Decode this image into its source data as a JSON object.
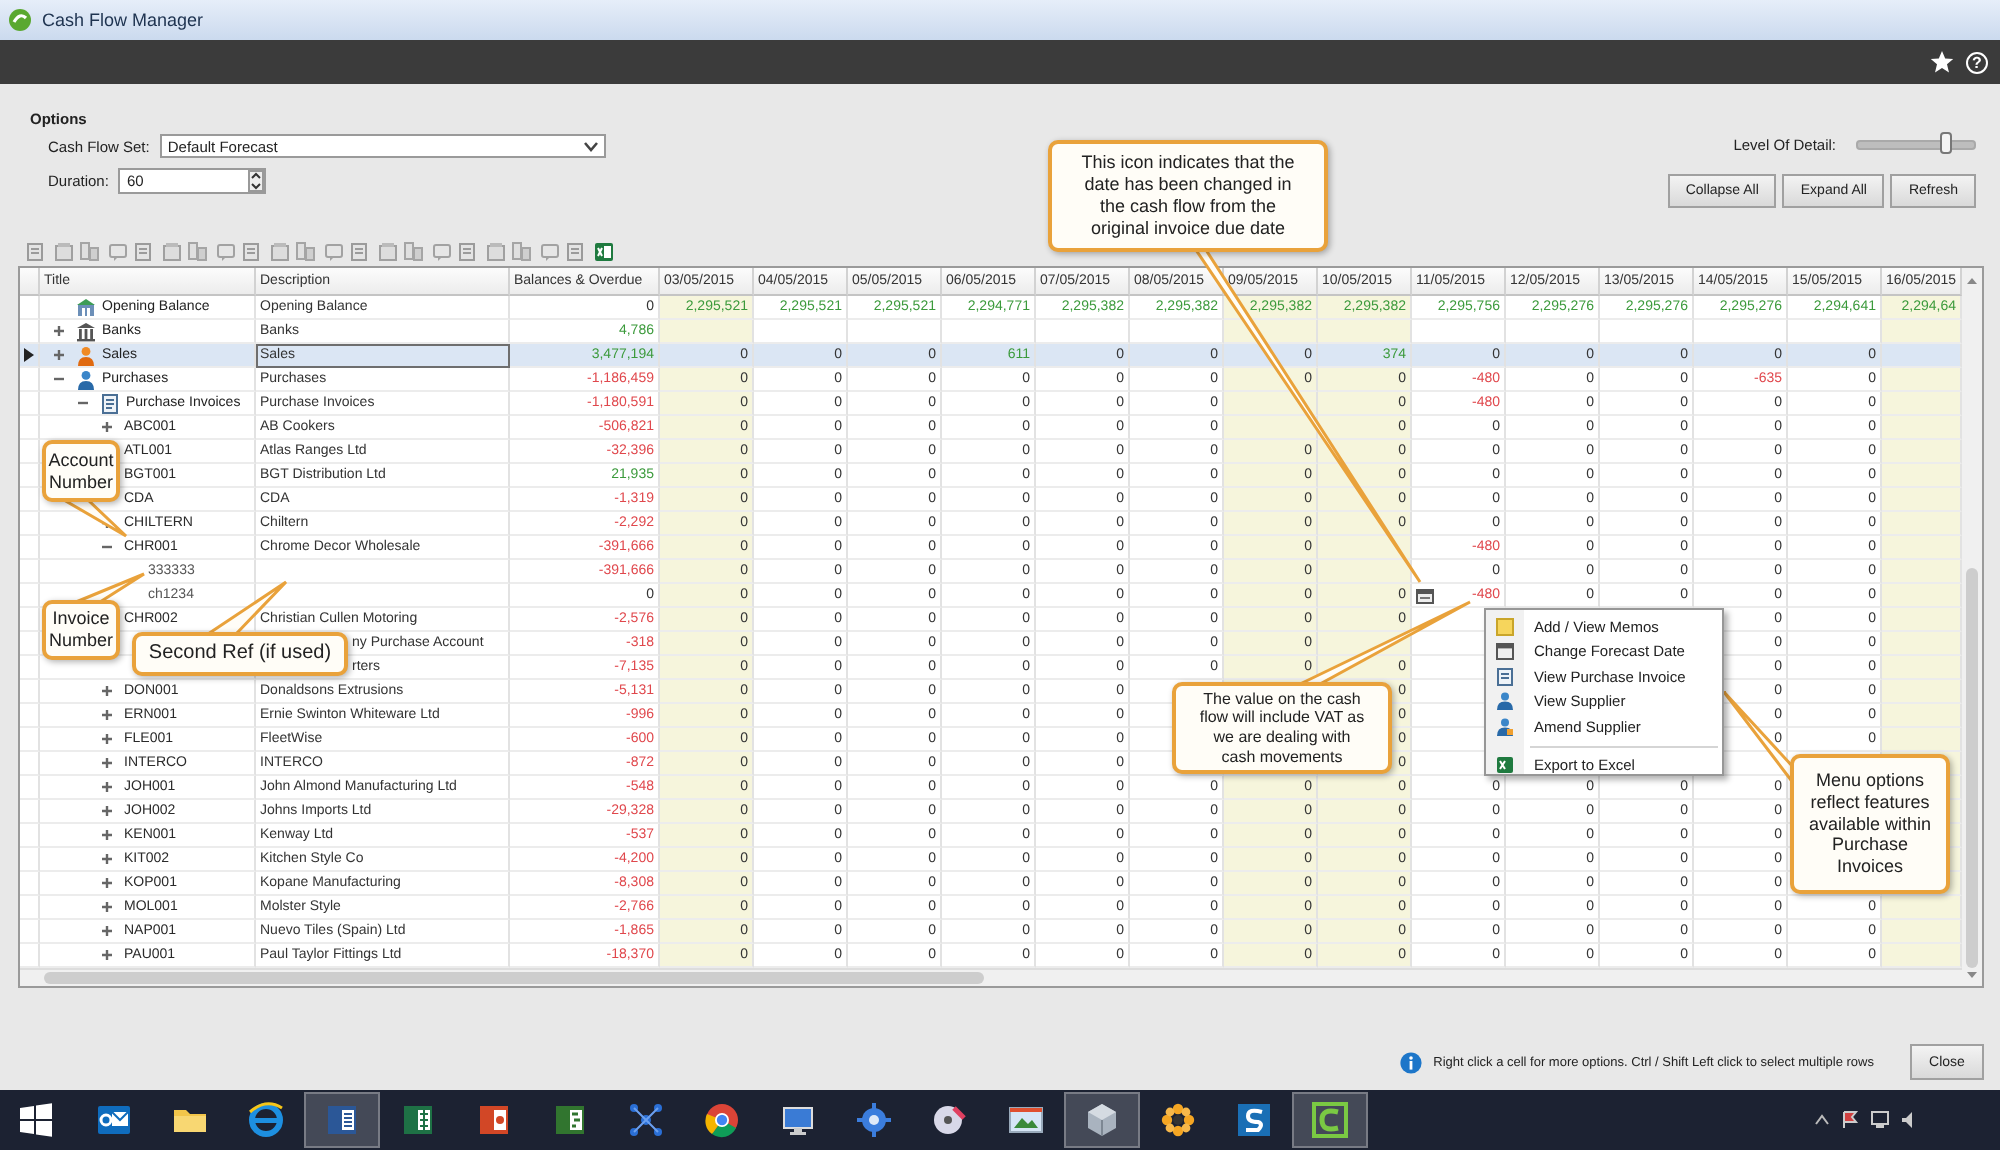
{
  "window": {
    "title": "Cash Flow Manager",
    "help_label": "?"
  },
  "options": {
    "title": "Options",
    "cash_flow_set": {
      "label": "Cash Flow Set:",
      "value": "Default Forecast"
    },
    "duration": {
      "label": "Duration:",
      "value": "60"
    },
    "level_of_detail": {
      "label": "Level Of Detail:",
      "level": 0.75
    },
    "buttons": [
      "Collapse All",
      "Expand All",
      "Refresh"
    ]
  },
  "grid": {
    "columns": [
      "Title",
      "Description",
      "Balances & Overdue"
    ],
    "date_columns": [
      {
        "label": "03/05/2015",
        "shaded": true
      },
      {
        "label": "04/05/2015",
        "shaded": false
      },
      {
        "label": "05/05/2015",
        "shaded": false
      },
      {
        "label": "06/05/2015",
        "shaded": false
      },
      {
        "label": "07/05/2015",
        "shaded": false
      },
      {
        "label": "08/05/2015",
        "shaded": false
      },
      {
        "label": "09/05/2015",
        "shaded": true
      },
      {
        "label": "10/05/2015",
        "shaded": true
      },
      {
        "label": "11/05/2015",
        "shaded": false
      },
      {
        "label": "12/05/2015",
        "shaded": false
      },
      {
        "label": "13/05/2015",
        "shaded": false
      },
      {
        "label": "14/05/2015",
        "shaded": false
      },
      {
        "label": "15/05/2015",
        "shaded": false
      },
      {
        "label": "16/05/2015",
        "shaded": true
      }
    ],
    "rows": [
      {
        "kind": "opening",
        "title": "Opening Balance",
        "description": "Opening Balance",
        "balance": {
          "text": "0"
        },
        "selected": false,
        "cells": [
          {
            "text": "2,295,521",
            "color": "#3b9a3b"
          },
          {
            "text": "2,295,521",
            "color": "#3b9a3b"
          },
          {
            "text": "2,295,521",
            "color": "#3b9a3b"
          },
          {
            "text": "2,294,771",
            "color": "#3b9a3b"
          },
          {
            "text": "2,295,382",
            "color": "#3b9a3b"
          },
          {
            "text": "2,295,382",
            "color": "#3b9a3b"
          },
          {
            "text": "2,295,382",
            "color": "#3b9a3b"
          },
          {
            "text": "2,295,382",
            "color": "#3b9a3b"
          },
          {
            "text": "2,295,756",
            "color": "#3b9a3b"
          },
          {
            "text": "2,295,276",
            "color": "#3b9a3b"
          },
          {
            "text": "2,295,276",
            "color": "#3b9a3b"
          },
          {
            "text": "2,295,276",
            "color": "#3b9a3b"
          },
          {
            "text": "2,294,641",
            "color": "#3b9a3b"
          },
          {
            "text": "2,294,64",
            "color": "#3b9a3b"
          }
        ]
      },
      {
        "kind": "bank",
        "title": "Banks",
        "description": "Banks",
        "balance": {
          "text": "4,786",
          "color": "#3b9a3b"
        },
        "selected": false,
        "expanded": false
      },
      {
        "kind": "sales",
        "title": "Sales",
        "description": "Sales",
        "balance": {
          "text": "3,477,194",
          "color": "#3b9a3b"
        },
        "selected": true,
        "expanded": false,
        "cells": [
          "0",
          "0",
          "0",
          {
            "text": "611",
            "color": "#3b9a3b"
          },
          "0",
          "0",
          "0",
          {
            "text": "374",
            "color": "#3b9a3b"
          },
          "0",
          "0",
          "0",
          "0",
          "0",
          null
        ]
      },
      {
        "kind": "purchases",
        "title": "Purchases",
        "description": "Purchases",
        "balance": {
          "text": "-1,186,459",
          "color": "#e0474c"
        },
        "selected": false,
        "expanded": true,
        "cells": [
          "0",
          "0",
          "0",
          "0",
          "0",
          "0",
          "0",
          "0",
          {
            "text": "-480",
            "color": "#e0474c"
          },
          "0",
          "0",
          {
            "text": "-635",
            "color": "#e0474c"
          },
          "0",
          null
        ],
        "children": [
          {
            "kind": "ledger",
            "title": "Purchase Invoices",
            "description": "Purchase Invoices",
            "balance": {
              "text": "-1,180,591",
              "color": "#e0474c"
            },
            "selected": false,
            "expanded": true,
            "cells": [
              "0",
              "0",
              "0",
              "0",
              "0",
              "0",
              null,
              "0",
              {
                "text": "-480",
                "color": "#e0474c"
              },
              "0",
              "0",
              "0",
              "0",
              null
            ],
            "children": [
              {
                "kind": "account",
                "title": "ABC001",
                "description": "AB Cookers",
                "balance": {
                  "text": "-506,821",
                  "color": "#e0474c"
                },
                "selected": false,
                "expanded": false,
                "cells": [
                  "0",
                  "0",
                  "0",
                  "0",
                  "0",
                  "0",
                  null,
                  "0",
                  "0",
                  "0",
                  "0",
                  "0",
                  "0",
                  null
                ]
              },
              {
                "kind": "account",
                "title": "ATL001",
                "description": "Atlas Ranges Ltd",
                "balance": {
                  "text": "-32,396",
                  "color": "#e0474c"
                },
                "selected": false,
                "cells": [
                  "0",
                  "0",
                  "0",
                  "0",
                  "0",
                  "0",
                  "0",
                  "0",
                  "0",
                  "0",
                  "0",
                  "0",
                  "0",
                  null
                ]
              },
              {
                "kind": "account",
                "title": "BGT001",
                "description": "BGT Distribution Ltd",
                "balance": {
                  "text": "21,935",
                  "color": "#3b9a3b"
                },
                "selected": false,
                "cells": [
                  "0",
                  "0",
                  "0",
                  "0",
                  "0",
                  "0",
                  "0",
                  "0",
                  "0",
                  "0",
                  "0",
                  "0",
                  "0",
                  null
                ]
              },
              {
                "kind": "account",
                "title": "CDA",
                "description": "CDA",
                "balance": {
                  "text": "-1,319",
                  "color": "#e0474c"
                },
                "selected": false,
                "cells": [
                  "0",
                  "0",
                  "0",
                  "0",
                  "0",
                  "0",
                  "0",
                  "0",
                  "0",
                  "0",
                  "0",
                  "0",
                  "0",
                  null
                ]
              },
              {
                "kind": "account",
                "title": "CHILTERN",
                "description": "Chiltern",
                "balance": {
                  "text": "-2,292",
                  "color": "#e0474c"
                },
                "selected": false,
                "expanded": false,
                "cells": [
                  "0",
                  "0",
                  "0",
                  "0",
                  "0",
                  "0",
                  "0",
                  "0",
                  "0",
                  "0",
                  "0",
                  "0",
                  "0",
                  null
                ]
              },
              {
                "kind": "account",
                "title": "CHR001",
                "description": "Chrome Decor Wholesale",
                "balance": {
                  "text": "-391,666",
                  "color": "#e0474c"
                },
                "selected": false,
                "expanded": true,
                "cells": [
                  "0",
                  "0",
                  "0",
                  "0",
                  "0",
                  "0",
                  "0",
                  null,
                  {
                    "text": "-480",
                    "color": "#e0474c"
                  },
                  "0",
                  "0",
                  "0",
                  "0",
                  null
                ],
                "children": [
                  {
                    "kind": "invoice",
                    "title": "333333",
                    "balance": {
                      "text": "-391,666",
                      "color": "#e0474c"
                    },
                    "selected": false,
                    "cells": [
                      "0",
                      "0",
                      "0",
                      "0",
                      "0",
                      "0",
                      "0",
                      null,
                      "0",
                      "0",
                      "0",
                      "0",
                      "0",
                      null
                    ]
                  },
                  {
                    "kind": "invoice",
                    "title": "ch1234",
                    "balance": {
                      "text": "0"
                    },
                    "selected": false,
                    "cells": [
                      "0",
                      "0",
                      "0",
                      "0",
                      "0",
                      "0",
                      "0",
                      "0",
                      {
                        "text": "-480",
                        "color": "#e0474c",
                        "date_changed": true
                      },
                      "0",
                      "0",
                      "0",
                      "0",
                      null
                    ]
                  }
                ]
              },
              {
                "kind": "account",
                "title": "CHR002",
                "description": "Christian Cullen Motoring",
                "balance": {
                  "text": "-2,576",
                  "color": "#e0474c"
                },
                "selected": false,
                "cells": [
                  "0",
                  "0",
                  "0",
                  "0",
                  "0",
                  "0",
                  "0",
                  "0",
                  null,
                  null,
                  null,
                  "0",
                  "0",
                  null
                ]
              },
              {
                "kind": "account",
                "description": "ny Purchase Account",
                "balance": {
                  "text": "-318",
                  "color": "#e0474c"
                },
                "selected": false,
                "cells": [
                  "0",
                  "0",
                  "0",
                  "0",
                  "0",
                  "0",
                  "0",
                  null,
                  null,
                  null,
                  null,
                  "0",
                  "0",
                  null
                ]
              },
              {
                "kind": "account",
                "description": "rters",
                "balance": {
                  "text": "-7,135",
                  "color": "#e0474c"
                },
                "selected": false,
                "cells": [
                  "0",
                  "0",
                  "0",
                  "0",
                  "0",
                  "0",
                  "0",
                  "0",
                  null,
                  null,
                  null,
                  "0",
                  "0",
                  null
                ]
              },
              {
                "kind": "account",
                "title": "DON001",
                "description": "Donaldsons Extrusions",
                "balance": {
                  "text": "-5,131",
                  "color": "#e0474c"
                },
                "selected": false,
                "expanded": false,
                "cells": [
                  "0",
                  "0",
                  "0",
                  "0",
                  "0",
                  null,
                  null,
                  "0",
                  null,
                  null,
                  null,
                  "0",
                  "0",
                  null
                ]
              },
              {
                "kind": "account",
                "title": "ERN001",
                "description": "Ernie Swinton Whiteware Ltd",
                "balance": {
                  "text": "-996",
                  "color": "#e0474c"
                },
                "selected": false,
                "expanded": false,
                "cells": [
                  "0",
                  "0",
                  "0",
                  "0",
                  "0",
                  null,
                  null,
                  "0",
                  null,
                  null,
                  null,
                  "0",
                  "0",
                  null
                ]
              },
              {
                "kind": "account",
                "title": "FLE001",
                "description": "FleetWise",
                "balance": {
                  "text": "-600",
                  "color": "#e0474c"
                },
                "selected": false,
                "expanded": false,
                "cells": [
                  "0",
                  "0",
                  "0",
                  "0",
                  "0",
                  null,
                  null,
                  "0",
                  null,
                  null,
                  null,
                  "0",
                  "0",
                  null
                ]
              },
              {
                "kind": "account",
                "title": "INTERCO",
                "description": "INTERCO",
                "balance": {
                  "text": "-872",
                  "color": "#e0474c"
                },
                "selected": false,
                "expanded": false,
                "cells": [
                  "0",
                  "0",
                  "0",
                  "0",
                  "0",
                  null,
                  null,
                  "0",
                  null,
                  null,
                  null,
                  null,
                  null,
                  null
                ]
              },
              {
                "kind": "account",
                "title": "JOH001",
                "description": "John Almond Manufacturing Ltd",
                "balance": {
                  "text": "-548",
                  "color": "#e0474c"
                },
                "selected": false,
                "expanded": false,
                "cells": [
                  "0",
                  "0",
                  "0",
                  "0",
                  "0",
                  "0",
                  "0",
                  "0",
                  "0",
                  "0",
                  "0",
                  "0",
                  null,
                  null
                ]
              },
              {
                "kind": "account",
                "title": "JOH002",
                "description": "Johns Imports Ltd",
                "balance": {
                  "text": "-29,328",
                  "color": "#e0474c"
                },
                "selected": false,
                "expanded": false,
                "cells": [
                  "0",
                  "0",
                  "0",
                  "0",
                  "0",
                  "0",
                  "0",
                  "0",
                  "0",
                  "0",
                  "0",
                  "0",
                  null,
                  null
                ]
              },
              {
                "kind": "account",
                "title": "KEN001",
                "description": "Kenway Ltd",
                "balance": {
                  "text": "-537",
                  "color": "#e0474c"
                },
                "selected": false,
                "expanded": false,
                "cells": [
                  "0",
                  "0",
                  "0",
                  "0",
                  "0",
                  "0",
                  "0",
                  "0",
                  "0",
                  "0",
                  "0",
                  "0",
                  null,
                  null
                ]
              },
              {
                "kind": "account",
                "title": "KIT002",
                "description": "Kitchen Style Co",
                "balance": {
                  "text": "-4,200",
                  "color": "#e0474c"
                },
                "selected": false,
                "expanded": false,
                "cells": [
                  "0",
                  "0",
                  "0",
                  "0",
                  "0",
                  "0",
                  "0",
                  "0",
                  "0",
                  "0",
                  "0",
                  "0",
                  null,
                  null
                ]
              },
              {
                "kind": "account",
                "title": "KOP001",
                "description": "Kopane Manufacturing",
                "balance": {
                  "text": "-8,308",
                  "color": "#e0474c"
                },
                "selected": false,
                "expanded": false,
                "cells": [
                  "0",
                  "0",
                  "0",
                  "0",
                  "0",
                  "0",
                  "0",
                  "0",
                  "0",
                  "0",
                  "0",
                  "0",
                  null,
                  null
                ]
              },
              {
                "kind": "account",
                "title": "MOL001",
                "description": "Molster Style",
                "balance": {
                  "text": "-2,766",
                  "color": "#e0474c"
                },
                "selected": false,
                "expanded": false,
                "cells": [
                  "0",
                  "0",
                  "0",
                  "0",
                  "0",
                  "0",
                  "0",
                  "0",
                  "0",
                  "0",
                  "0",
                  "0",
                  "0",
                  null
                ]
              },
              {
                "kind": "account",
                "title": "NAP001",
                "description": "Nuevo Tiles (Spain) Ltd",
                "balance": {
                  "text": "-1,865",
                  "color": "#e0474c"
                },
                "selected": false,
                "expanded": false,
                "cells": [
                  "0",
                  "0",
                  "0",
                  "0",
                  "0",
                  "0",
                  "0",
                  "0",
                  "0",
                  "0",
                  "0",
                  "0",
                  "0",
                  null
                ]
              },
              {
                "kind": "account",
                "title": "PAU001",
                "description": "Paul Taylor Fittings Ltd",
                "balance": {
                  "text": "-18,370",
                  "color": "#e0474c"
                },
                "selected": false,
                "expanded": false,
                "cells": [
                  "0",
                  "0",
                  "0",
                  "0",
                  "0",
                  "0",
                  "0",
                  "0",
                  "0",
                  "0",
                  "0",
                  "0",
                  "0",
                  null
                ]
              }
            ]
          }
        ]
      }
    ]
  },
  "context_menu": {
    "items": [
      {
        "label": "Add / View Memos"
      },
      {
        "label": "Change Forecast Date"
      },
      {
        "label": "View Purchase Invoice"
      },
      {
        "label": "View Supplier"
      },
      {
        "label": "Amend Supplier"
      },
      {
        "label": "Export to Excel",
        "separator_before": true
      }
    ]
  },
  "callouts": [
    {
      "text": "This icon indicates that the\ndate has been changed in\nthe cash flow from the\noriginal invoice due date"
    },
    {
      "text": "Account\nNumber"
    },
    {
      "text": "Invoice\nNumber"
    },
    {
      "text": "Second Ref (if used)"
    },
    {
      "text": "The value on the cash\nflow will include VAT as\nwe are dealing with\ncash movements"
    },
    {
      "text": "Menu options\nreflect features\navailable within\nPurchase\nInvoices"
    }
  ],
  "status_bar": {
    "message": "Right click a cell for more options. Ctrl / Shift Left click to select multiple rows",
    "buttons": [
      "Close"
    ]
  },
  "taskbar": {
    "apps": [
      {
        "selected": false
      },
      {
        "selected": false
      },
      {
        "selected": false
      },
      {
        "selected": true
      },
      {
        "selected": false
      },
      {
        "selected": false
      },
      {
        "selected": false
      },
      {
        "selected": false
      },
      {
        "selected": false
      },
      {
        "selected": false
      },
      {
        "selected": false
      },
      {
        "selected": false
      },
      {
        "selected": false
      },
      {
        "selected": true
      },
      {
        "selected": false
      },
      {
        "selected": false
      },
      {
        "selected": true
      }
    ]
  }
}
